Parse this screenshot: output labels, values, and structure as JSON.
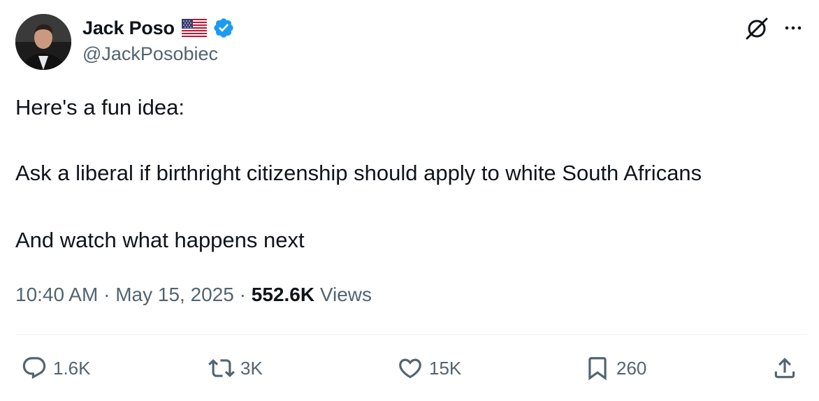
{
  "author": {
    "display_name": "Jack Poso",
    "handle": "@JackPosobiec",
    "badges": [
      "us-flag-emoji",
      "verified-badge-icon"
    ]
  },
  "post": {
    "lines": [
      "Here's a fun idea:",
      "Ask a liberal if birthright citizenship should apply to white South Africans",
      "And watch what happens next"
    ],
    "time": "10:40 AM",
    "date": "May 15, 2025",
    "views_count": "552.6K",
    "views_label": "Views"
  },
  "actions": {
    "replies": "1.6K",
    "reposts": "3K",
    "likes": "15K",
    "bookmarks": "260"
  },
  "colors": {
    "text": "#0f1419",
    "secondary": "#536471",
    "verified": "#1d9bf0",
    "divider": "#eff3f4"
  },
  "icons": [
    "grok-icon",
    "more-icon",
    "reply-icon",
    "repost-icon",
    "like-icon",
    "bookmark-icon",
    "share-icon"
  ]
}
